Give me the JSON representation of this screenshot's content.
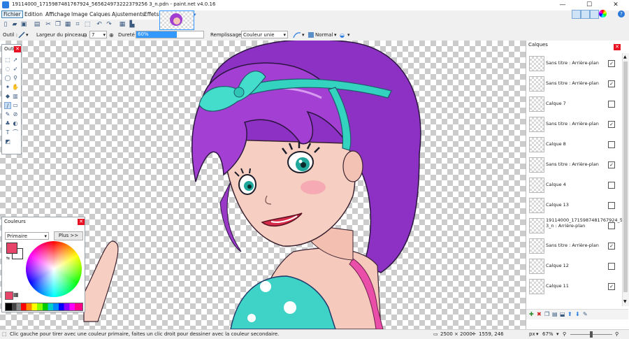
{
  "window": {
    "title": "19114000_1715987481767924_565624973222379256 3_n.pdn - paint.net v4.0.16",
    "minimize": "—",
    "maximize": "☐",
    "close": "✕"
  },
  "menu": [
    "Fichier",
    "Edition",
    "Affichage",
    "Image",
    "Calques",
    "Ajustements",
    "Effets"
  ],
  "toolbar": {
    "tool_label": "Outil :",
    "brush_width_label": "Largeur du pinceau :",
    "brush_width_value": "7",
    "hardness_label": "Dureté :",
    "hardness_value": "60%",
    "hardness_fraction": 0.6,
    "fill_label": "Remplissage :",
    "fill_value": "Couleur unie",
    "blend_value": "Normal"
  },
  "tools_panel": {
    "title": "Outi..."
  },
  "colors_panel": {
    "title": "Couleurs",
    "mode": "Primaire",
    "more_button": "Plus >>",
    "primary_color": "#e8456b",
    "secondary_color": "#ffffff"
  },
  "layers_panel": {
    "title": "Calques",
    "items": [
      {
        "name": "Sans titre : Arrière-plan",
        "visible": true
      },
      {
        "name": "Sans titre : Arrière-plan",
        "visible": true
      },
      {
        "name": "Calque 7",
        "visible": false
      },
      {
        "name": "Sans titre : Arrière-plan",
        "visible": true
      },
      {
        "name": "Calque 8",
        "visible": false
      },
      {
        "name": "Sans titre : Arrière-plan",
        "visible": true
      },
      {
        "name": "Calque 4",
        "visible": false
      },
      {
        "name": "Calque 13",
        "visible": false
      },
      {
        "name": "19114000_1715987481767924_565624973222379256 3_n : Arrière-plan",
        "visible": false
      },
      {
        "name": "Sans titre : Arrière-plan",
        "visible": true
      },
      {
        "name": "Calque 12",
        "visible": false
      },
      {
        "name": "Calque 11",
        "visible": true
      }
    ]
  },
  "status": {
    "hint": "Clic gauche pour tirer avec une couleur primaire, faites un clic droit pour dessiner avec la couleur secondaire.",
    "image_size": "2500 × 2000",
    "cursor_pos": "1559, 246",
    "unit": "px",
    "zoom": "67%"
  }
}
